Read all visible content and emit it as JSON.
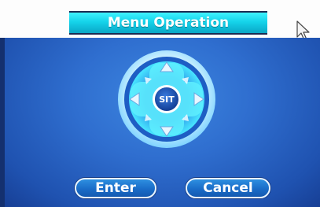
{
  "dialog": {
    "title": "Menu Operation"
  },
  "joystick": {
    "center_label": "SIT",
    "directions": [
      "up",
      "down",
      "left",
      "right"
    ]
  },
  "buttons": {
    "enter_label": "Enter",
    "cancel_label": "Cancel"
  },
  "colors": {
    "title_bar": "#15d3ea",
    "panel": "#2f6ecf",
    "joystick_glow": "#48e6ff",
    "button_border": "#e8f4ff"
  },
  "icons": {
    "cursor": "mouse-pointer-icon"
  }
}
